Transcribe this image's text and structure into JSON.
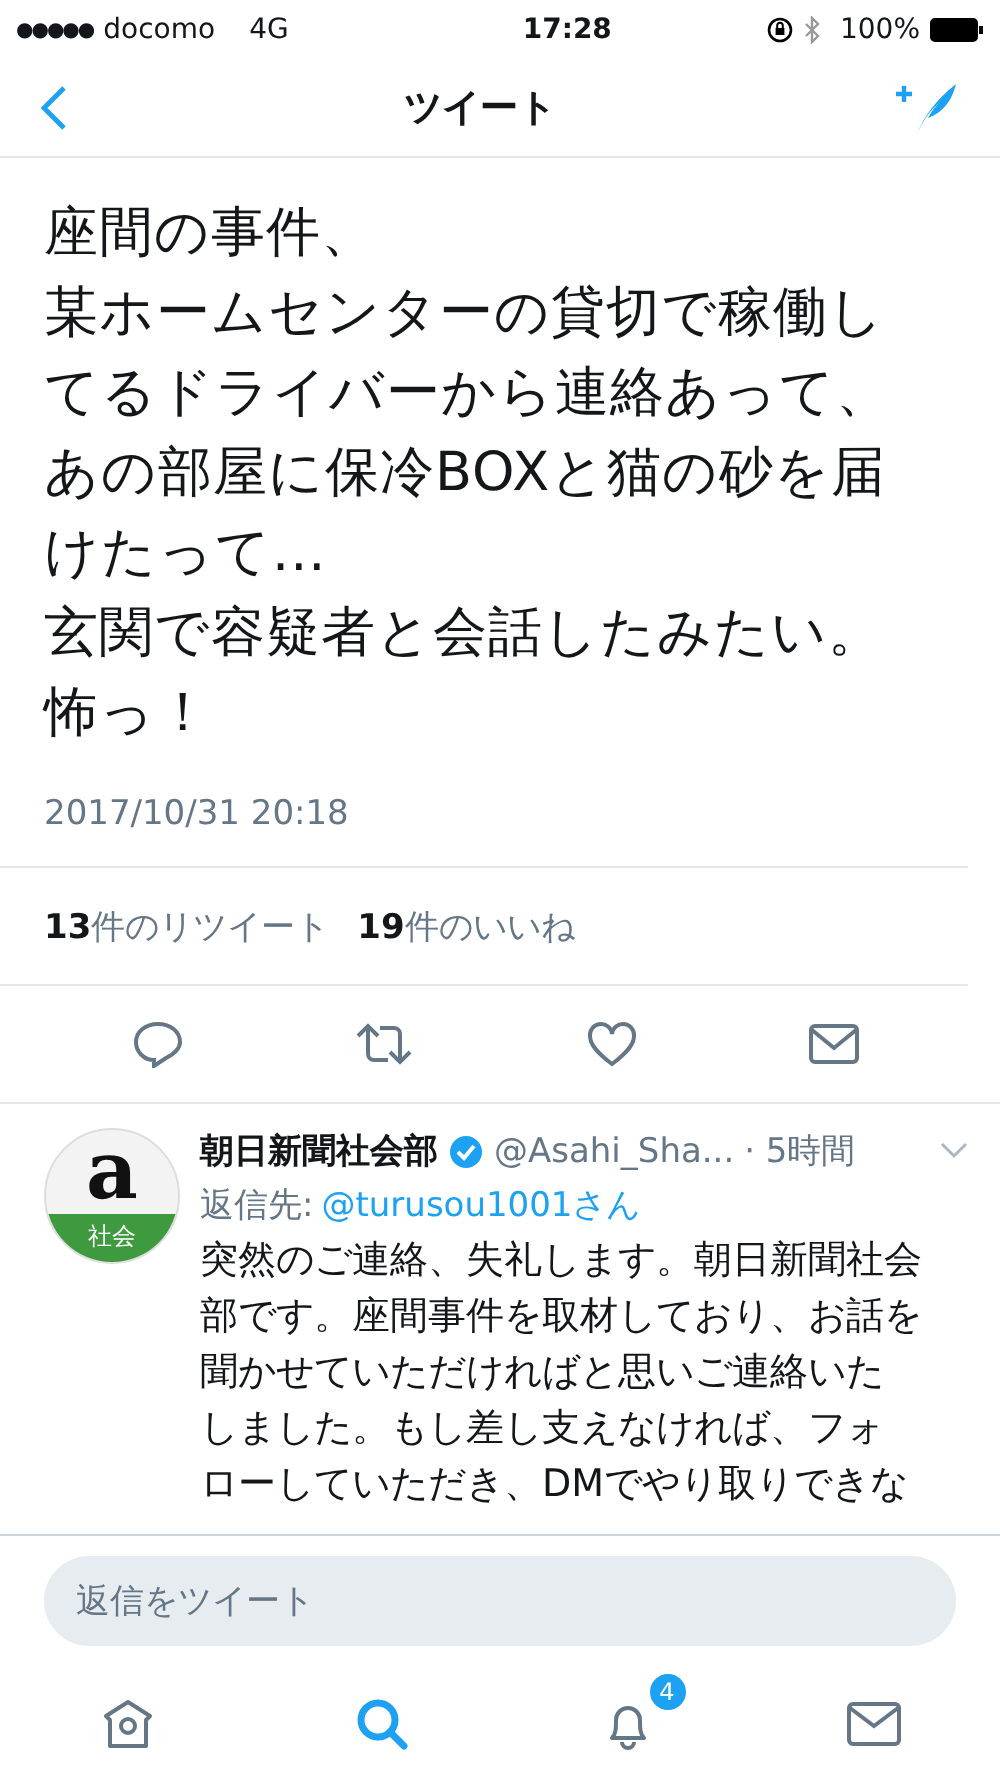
{
  "status_bar": {
    "signal": "●●●●●",
    "carrier": "docomo",
    "network": "4G",
    "time": "17:28",
    "battery": "100%"
  },
  "nav": {
    "title": "ツイート"
  },
  "tweet": {
    "lines": [
      "座間の事件、",
      "某ホームセンターの貸切で稼働し",
      "てるドライバーから連絡あって、",
      "あの部屋に保冷BOXと猫の砂を届",
      "けたって...",
      "玄関で容疑者と会話したみたい。",
      "怖っ！"
    ],
    "timestamp": "2017/10/31 20:18",
    "retweets": {
      "count": "13",
      "label": "件のリツイート"
    },
    "likes": {
      "count": "19",
      "label": "件のいいね"
    }
  },
  "reply": {
    "avatar": {
      "letter": "a",
      "caption": "社会"
    },
    "name": "朝日新聞社会部",
    "verified": true,
    "handle": "@Asahi_Sha...",
    "time": "· 5時間",
    "reply_to_label": "返信先:",
    "reply_to": "@turusou1001さん",
    "lines": [
      "突然のご連絡、失礼します。朝日新聞社会",
      "部です。座間事件を取材しており、お話を",
      "聞かせていただければと思いご連絡いた",
      "しました。もし差し支えなければ、フォ",
      "ローしていただき、DMでやり取りできな"
    ]
  },
  "composer": {
    "placeholder": "返信をツイート"
  },
  "tab_bar": [
    {
      "kind": "home",
      "selected": false
    },
    {
      "kind": "search",
      "selected": true
    },
    {
      "kind": "notifications",
      "selected": false,
      "badge": "4"
    },
    {
      "kind": "messages",
      "selected": false
    }
  ]
}
